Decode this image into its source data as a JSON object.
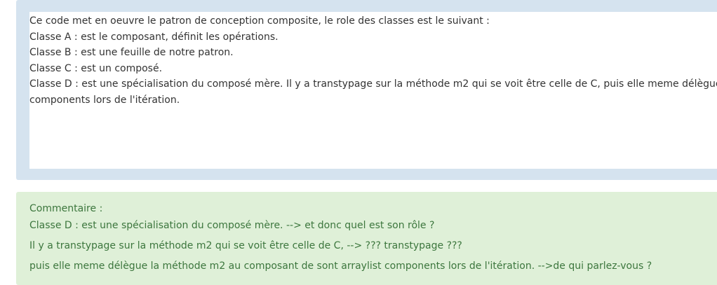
{
  "answer": {
    "lines": [
      "Ce code met en oeuvre le patron de conception composite, le role des classes est le suivant :",
      "Classe A : est le composant, définit les opérations.",
      "Classe B : est une feuille de notre patron.",
      "Classe C : est un composé.",
      "Classe D : est une spécialisation du composé mère. Il y a transtypage sur la méthode m2 qui se voit être celle de C, puis elle meme délègue la",
      "components lors de l'itération."
    ]
  },
  "feedback": {
    "title": "Commentaire :",
    "lines": [
      "Classe D : est une spécialisation du composé mère. --> et donc quel est son rôle ?",
      "Il y a transtypage sur la méthode m2 qui se voit être celle de C, --> ??? transtypage ???",
      "puis elle meme délègue la méthode m2 au composant de sont arraylist components lors de l'itération. -->de qui parlez-vous ?"
    ]
  },
  "colors": {
    "answer_panel_bg": "#d5e3ef",
    "answer_box_bg": "#ffffff",
    "feedback_bg": "#dff0d8",
    "feedback_text": "#3c763d",
    "body_text": "#333333"
  }
}
